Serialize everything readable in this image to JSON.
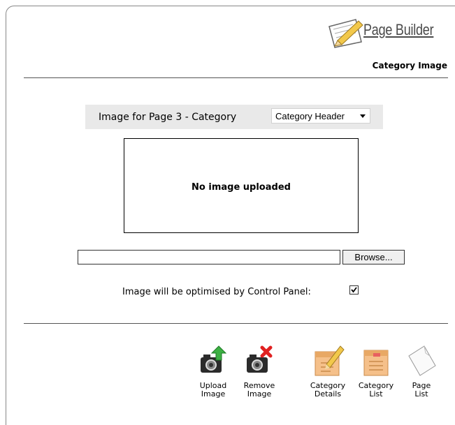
{
  "header": {
    "app_title": "Page Builder",
    "page_subtitle": "Category Image"
  },
  "image_section": {
    "label": "Image for Page 3 - Category",
    "select": {
      "selected": "Category Header"
    },
    "preview_text": "No image uploaded"
  },
  "upload": {
    "file_value": "",
    "browse_label": "Browse..."
  },
  "optimise": {
    "label": "Image will be optimised by Control Panel:",
    "checked": true
  },
  "actions": [
    {
      "label": "Upload\nImage",
      "icon": "camera-upload-icon"
    },
    {
      "label": "Remove\nImage",
      "icon": "camera-remove-icon"
    },
    {
      "label": "Category\nDetails",
      "icon": "folder-edit-icon"
    },
    {
      "label": "Category\nList",
      "icon": "folder-list-icon"
    },
    {
      "label": "Page\nList",
      "icon": "page-icon"
    }
  ],
  "colors": {
    "bar_background": "#e9e9e9",
    "upload_arrow": "#3cb043",
    "remove_x": "#e02020",
    "folder": "#f5c08a"
  }
}
